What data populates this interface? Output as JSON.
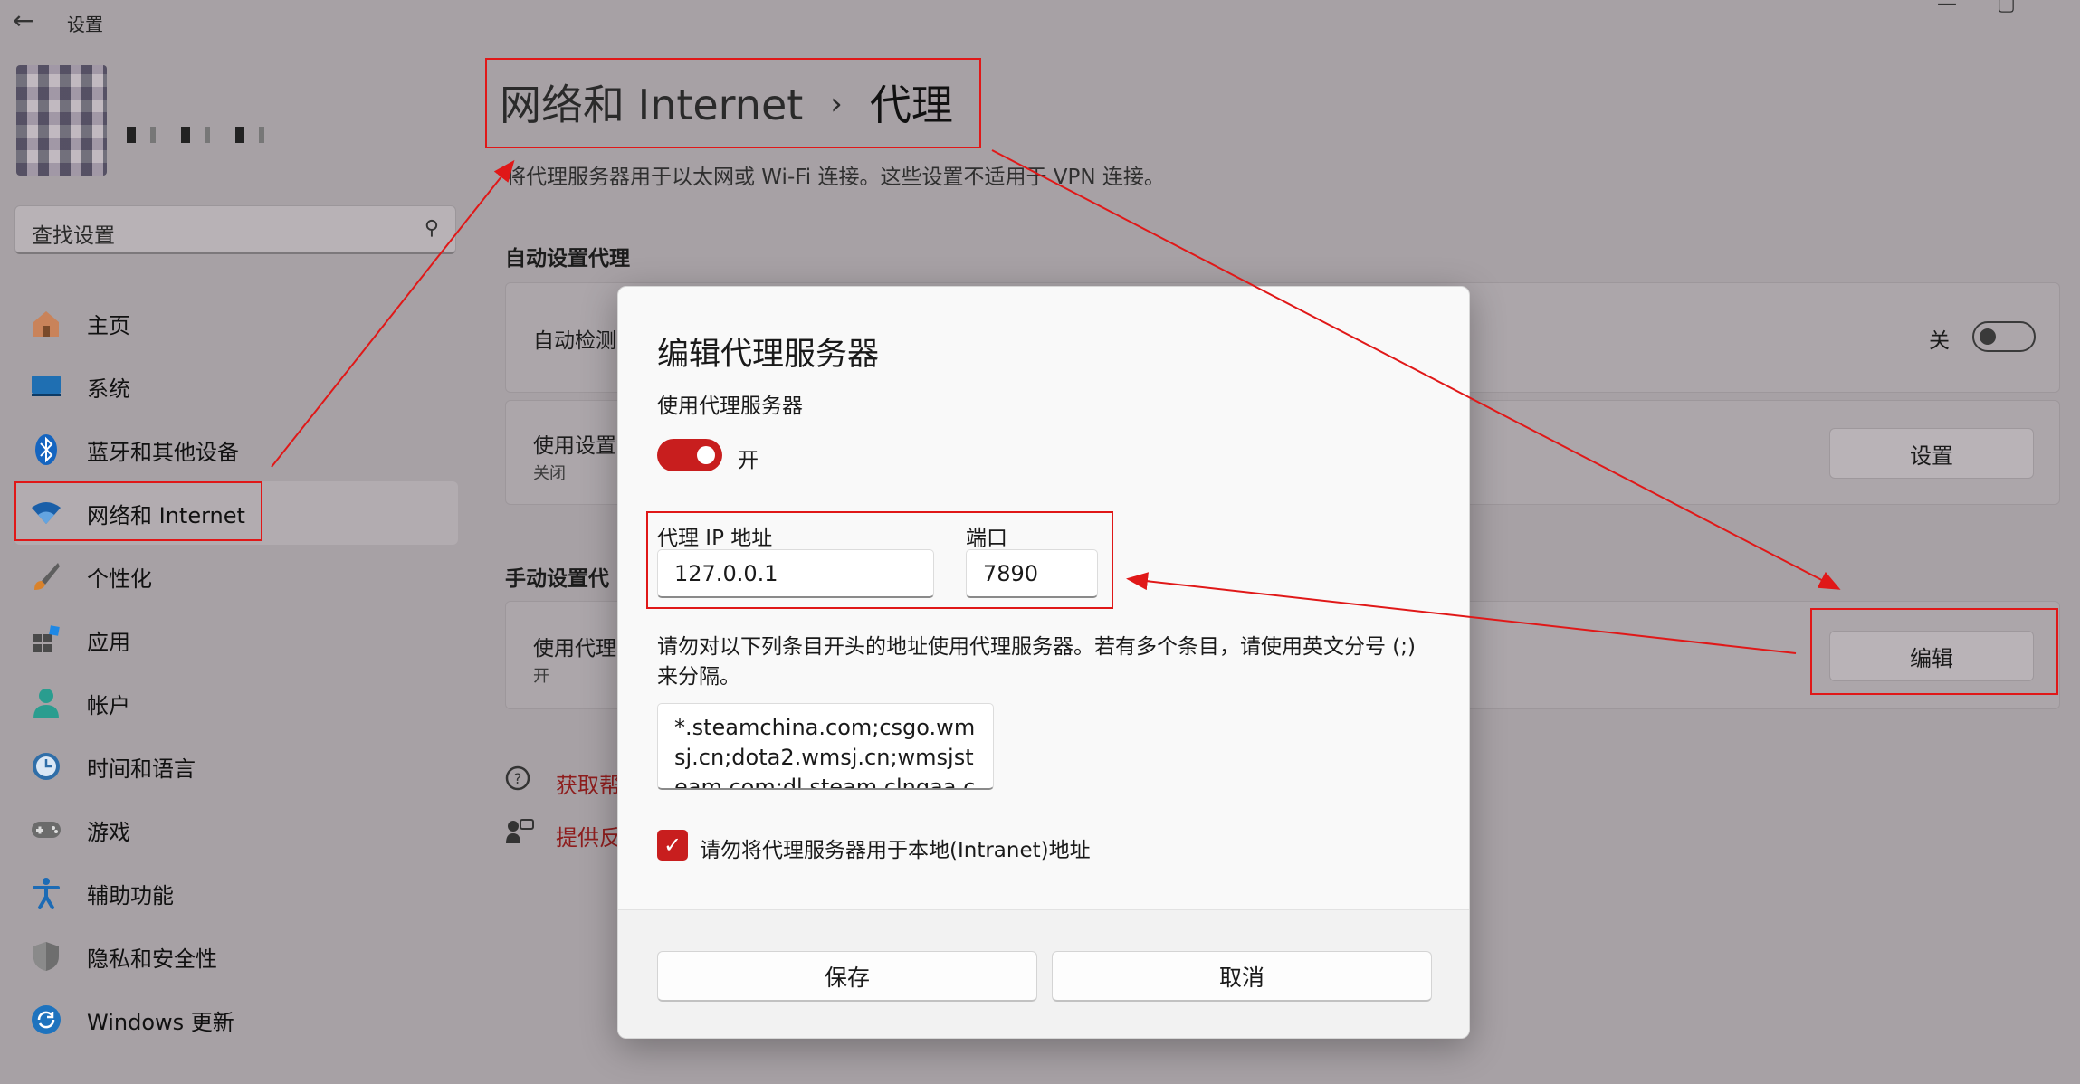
{
  "window": {
    "title": "设置",
    "back_icon": "←",
    "min_icon": "—",
    "max_icon": "▢",
    "close_icon": "✕"
  },
  "search": {
    "placeholder": "查找设置",
    "icon": "⚲"
  },
  "sidebar": {
    "items": [
      {
        "label": "主页",
        "icon": "home-icon"
      },
      {
        "label": "系统",
        "icon": "system-icon"
      },
      {
        "label": "蓝牙和其他设备",
        "icon": "bluetooth-icon"
      },
      {
        "label": "网络和 Internet",
        "icon": "wifi-icon"
      },
      {
        "label": "个性化",
        "icon": "brush-icon"
      },
      {
        "label": "应用",
        "icon": "apps-icon"
      },
      {
        "label": "帐户",
        "icon": "account-icon"
      },
      {
        "label": "时间和语言",
        "icon": "clock-icon"
      },
      {
        "label": "游戏",
        "icon": "gamepad-icon"
      },
      {
        "label": "辅助功能",
        "icon": "accessibility-icon"
      },
      {
        "label": "隐私和安全性",
        "icon": "shield-icon"
      },
      {
        "label": "Windows 更新",
        "icon": "update-icon"
      }
    ]
  },
  "header": {
    "parent": "网络和 Internet",
    "separator": "›",
    "current": "代理"
  },
  "main": {
    "description": "将代理服务器用于以太网或 Wi-Fi 连接。这些设置不适用于 VPN 连接。",
    "auto_section": "自动设置代理",
    "auto_detect_label": "自动检测",
    "auto_detect_state": "关",
    "use_setup_script_label": "使用设置",
    "use_setup_script_sub": "关闭",
    "setup_button": "设置",
    "manual_section": "手动设置代",
    "use_proxy_label": "使用代理",
    "use_proxy_sub": "开",
    "edit_button": "编辑",
    "help_link": "获取帮",
    "feedback_link": "提供反"
  },
  "dialog": {
    "title": "编辑代理服务器",
    "use_proxy_label": "使用代理服务器",
    "toggle_state": "开",
    "ip_label": "代理 IP 地址",
    "ip_value": "127.0.0.1",
    "port_label": "端口",
    "port_value": "7890",
    "exceptions_hint": "请勿对以下列条目开头的地址使用代理服务器。若有多个条目，请使用英文分号 (;) 来分隔。",
    "exceptions_value": "*.steamchina.com;csgo.wmsj.cn;dota2.wmsj.cn;wmsjsteam.com;dl.steam.clngaa.com;dl.steam.ksyna.com;st.dl.bscstorage.net",
    "local_checkbox_label": "请勿将代理服务器用于本地(Intranet)地址",
    "local_checkbox_checked": true,
    "save_button": "保存",
    "cancel_button": "取消"
  },
  "colors": {
    "accent": "#c81e1e",
    "annotation": "#e01818",
    "dim_background": "#a7a1a5"
  }
}
